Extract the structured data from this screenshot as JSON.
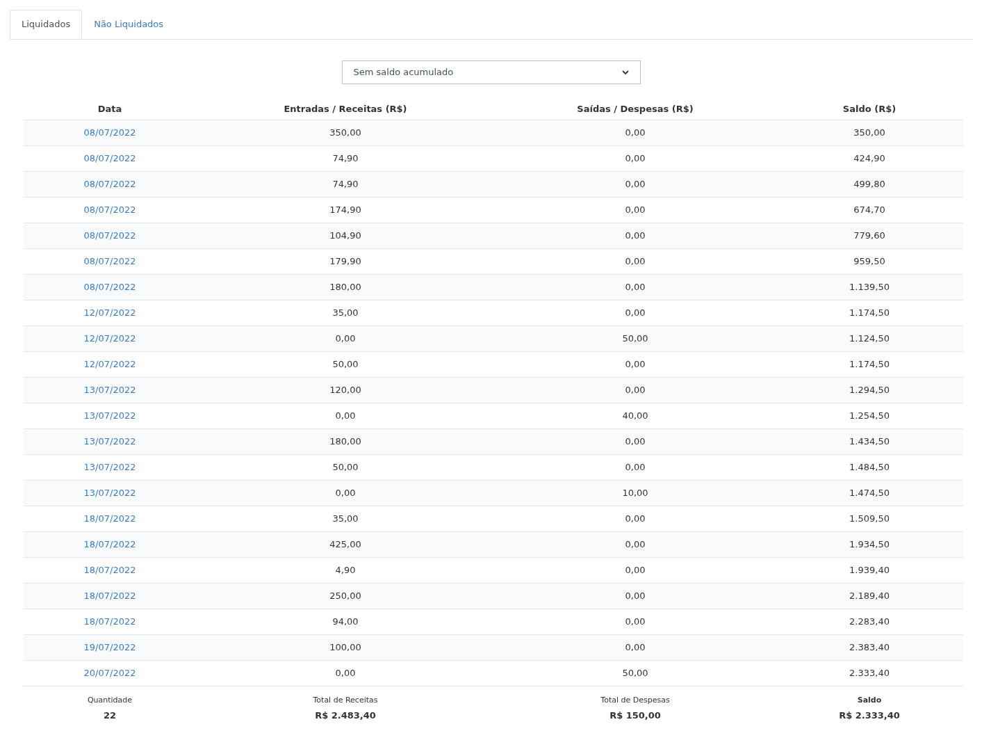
{
  "tabs": [
    {
      "label": "Liquidados",
      "selected": true
    },
    {
      "label": "Não Liquidados",
      "selected": false
    }
  ],
  "filter": {
    "value": "Sem saldo acumulado"
  },
  "table": {
    "columns": [
      "Data",
      "Entradas / Receitas (R$)",
      "Saídas / Despesas (R$)",
      "Saldo (R$)"
    ],
    "rows": [
      [
        "08/07/2022",
        "350,00",
        "0,00",
        "350,00"
      ],
      [
        "08/07/2022",
        "74,90",
        "0,00",
        "424,90"
      ],
      [
        "08/07/2022",
        "74,90",
        "0,00",
        "499,80"
      ],
      [
        "08/07/2022",
        "174,90",
        "0,00",
        "674,70"
      ],
      [
        "08/07/2022",
        "104,90",
        "0,00",
        "779,60"
      ],
      [
        "08/07/2022",
        "179,90",
        "0,00",
        "959,50"
      ],
      [
        "08/07/2022",
        "180,00",
        "0,00",
        "1.139,50"
      ],
      [
        "12/07/2022",
        "35,00",
        "0,00",
        "1.174,50"
      ],
      [
        "12/07/2022",
        "0,00",
        "50,00",
        "1.124,50"
      ],
      [
        "12/07/2022",
        "50,00",
        "0,00",
        "1.174,50"
      ],
      [
        "13/07/2022",
        "120,00",
        "0,00",
        "1.294,50"
      ],
      [
        "13/07/2022",
        "0,00",
        "40,00",
        "1.254,50"
      ],
      [
        "13/07/2022",
        "180,00",
        "0,00",
        "1.434,50"
      ],
      [
        "13/07/2022",
        "50,00",
        "0,00",
        "1.484,50"
      ],
      [
        "13/07/2022",
        "0,00",
        "10,00",
        "1.474,50"
      ],
      [
        "18/07/2022",
        "35,00",
        "0,00",
        "1.509,50"
      ],
      [
        "18/07/2022",
        "425,00",
        "0,00",
        "1.934,50"
      ],
      [
        "18/07/2022",
        "4,90",
        "0,00",
        "1.939,40"
      ],
      [
        "18/07/2022",
        "250,00",
        "0,00",
        "2.189,40"
      ],
      [
        "18/07/2022",
        "94,00",
        "0,00",
        "2.283,40"
      ],
      [
        "19/07/2022",
        "100,00",
        "0,00",
        "2.383,40"
      ],
      [
        "20/07/2022",
        "0,00",
        "50,00",
        "2.333,40"
      ]
    ],
    "summary": [
      {
        "label": "Quantidade",
        "value": "22",
        "bold": false
      },
      {
        "label": "Total de Receitas",
        "value": "R$ 2.483,40",
        "bold": false
      },
      {
        "label": "Total de Despesas",
        "value": "R$ 150,00",
        "bold": false
      },
      {
        "label": "Saldo",
        "value": "R$ 2.333,40",
        "bold": true
      }
    ]
  }
}
